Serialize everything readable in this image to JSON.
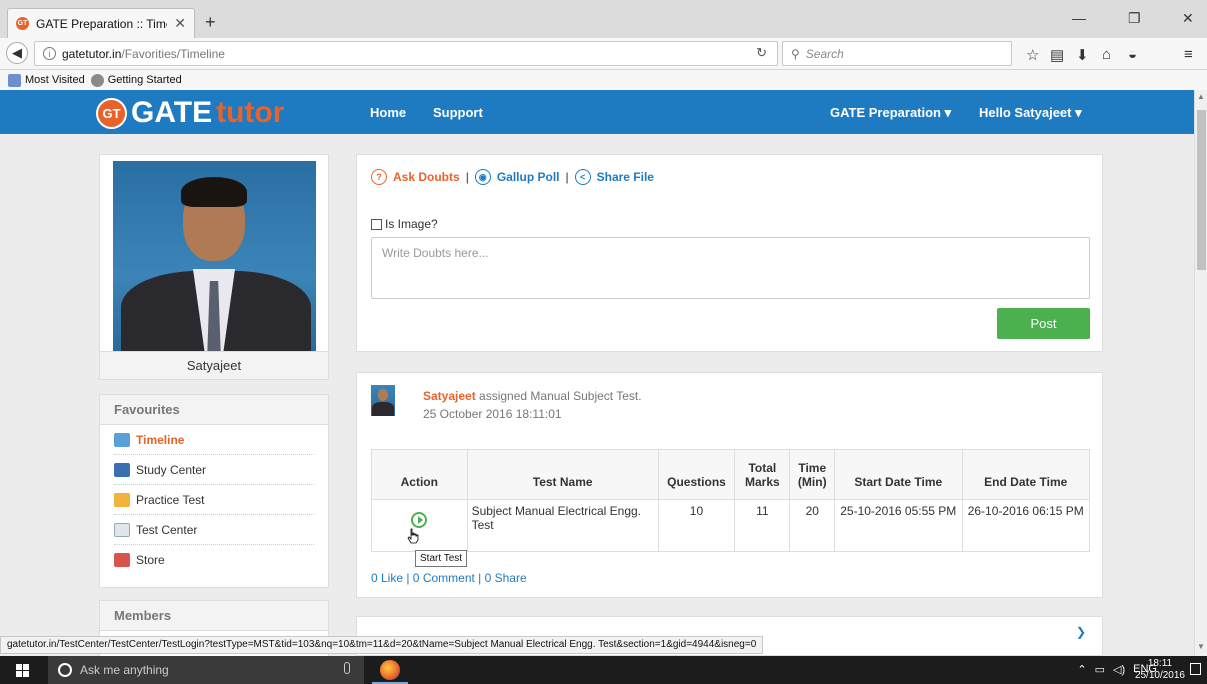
{
  "browser": {
    "tab_title": "GATE Preparation :: Timeli...",
    "tab_close": "✕",
    "new_tab": "+",
    "url_domain": "gatetutor.in",
    "url_path": "/Favorities/Timeline",
    "search_placeholder": "Search",
    "bookmarks": [
      "Most Visited",
      "Getting Started"
    ],
    "status_url": "gatetutor.in/TestCenter/TestCenter/TestLogin?testType=MST&tid=103&nq=10&tm=11&d=20&tName=Subject Manual Electrical Engg. Test&section=1&gid=4944&isneg=0"
  },
  "header": {
    "logo_badge": "GT",
    "logo_gate": "GATE",
    "logo_tutor": "tutor",
    "nav": [
      "Home",
      "Support"
    ],
    "right_nav": [
      "GATE Preparation ▾",
      "Hello Satyajeet ▾"
    ]
  },
  "profile": {
    "name": "Satyajeet"
  },
  "favourites": {
    "title": "Favourites",
    "items": [
      "Timeline",
      "Study Center",
      "Practice Test",
      "Test Center",
      "Store"
    ]
  },
  "members": {
    "title": "Members"
  },
  "composer": {
    "ask_doubts": "Ask Doubts",
    "gallup_poll": "Gallup Poll",
    "share_file": "Share File",
    "separator": "|",
    "is_image_label": "Is Image?",
    "placeholder": "Write Doubts here...",
    "post_label": "Post"
  },
  "feed": {
    "user": "Satyajeet",
    "action": "assigned Manual Subject Test.",
    "timestamp": "25 October 2016 18:11:01",
    "table": {
      "headers": [
        "Action",
        "Test Name",
        "Questions",
        "Total Marks",
        "Time (Min)",
        "Start Date Time",
        "End Date Time"
      ],
      "row": {
        "test_name": "Subject Manual Electrical Engg. Test",
        "questions": "10",
        "total_marks": "11",
        "time": "20",
        "start": "25-10-2016 05:55 PM",
        "end": "26-10-2016 06:15 PM"
      }
    },
    "tooltip": "Start Test",
    "links": "0 Like | 0 Comment | 0 Share"
  },
  "taskbar": {
    "search_placeholder": "Ask me anything",
    "lang": "ENG",
    "time": "18:11",
    "date": "25/10/2016"
  },
  "colors": {
    "header_blue": "#1f7bc1",
    "accent_orange": "#e8632b",
    "post_green": "#4caf50"
  }
}
